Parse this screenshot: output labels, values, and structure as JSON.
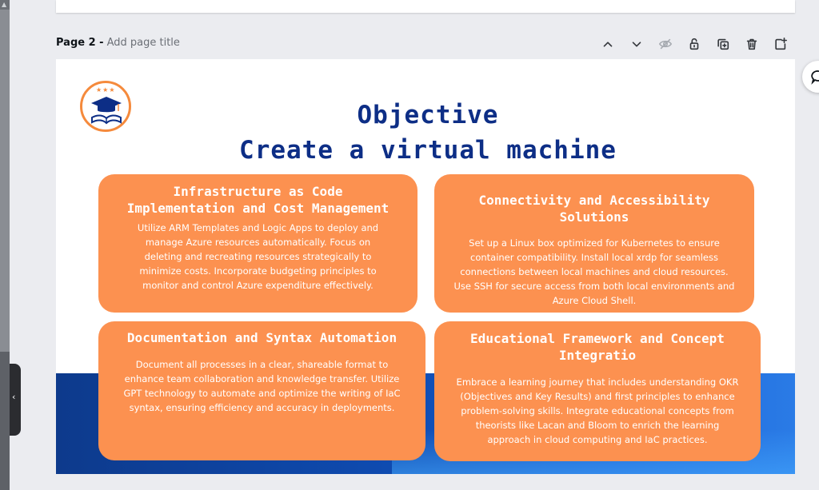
{
  "page": {
    "label": "Page 2 -",
    "title_placeholder": "Add page title"
  },
  "toolbar": [
    "chevron-up-icon",
    "chevron-down-icon",
    "hide-icon",
    "lock-icon",
    "duplicate-icon",
    "delete-icon",
    "add-page-icon"
  ],
  "slide": {
    "heading1": "Objective",
    "heading2": "Create a virtual machine",
    "cards": [
      {
        "title": "Infrastructure as Code Implementation and Cost Management",
        "body": "Utilize ARM Templates and Logic Apps to deploy and manage Azure resources automatically. Focus on deleting and recreating resources strategically to minimize costs. Incorporate budgeting principles to monitor and control Azure expenditure effectively."
      },
      {
        "title": "Connectivity and Accessibility Solutions",
        "body": "Set up a Linux box optimized for Kubernetes to ensure container compatibility. Install local xrdp for seamless connections between local machines and cloud resources. Use SSH for secure access from both local environments and Azure Cloud Shell."
      },
      {
        "title": "Documentation and Syntax Automation",
        "body": "Document all processes in a clear, shareable format to enhance team collaboration and knowledge transfer. Utilize GPT technology to automate and optimize the writing of IaC syntax, ensuring efficiency and accuracy in deployments."
      },
      {
        "title": "Educational Framework and Concept Integratio",
        "body": "Embrace a learning journey that includes understanding OKR (Objectives and Key Results) and first principles to enhance problem-solving skills. Integrate educational concepts from theorists like Lacan and Bloom to enrich the learning approach in cloud computing and IaC practices."
      }
    ]
  },
  "colors": {
    "card": "#fc9150",
    "heading": "#0d2e86",
    "band": "#0f4bb0",
    "logo": "#f58a3c"
  }
}
